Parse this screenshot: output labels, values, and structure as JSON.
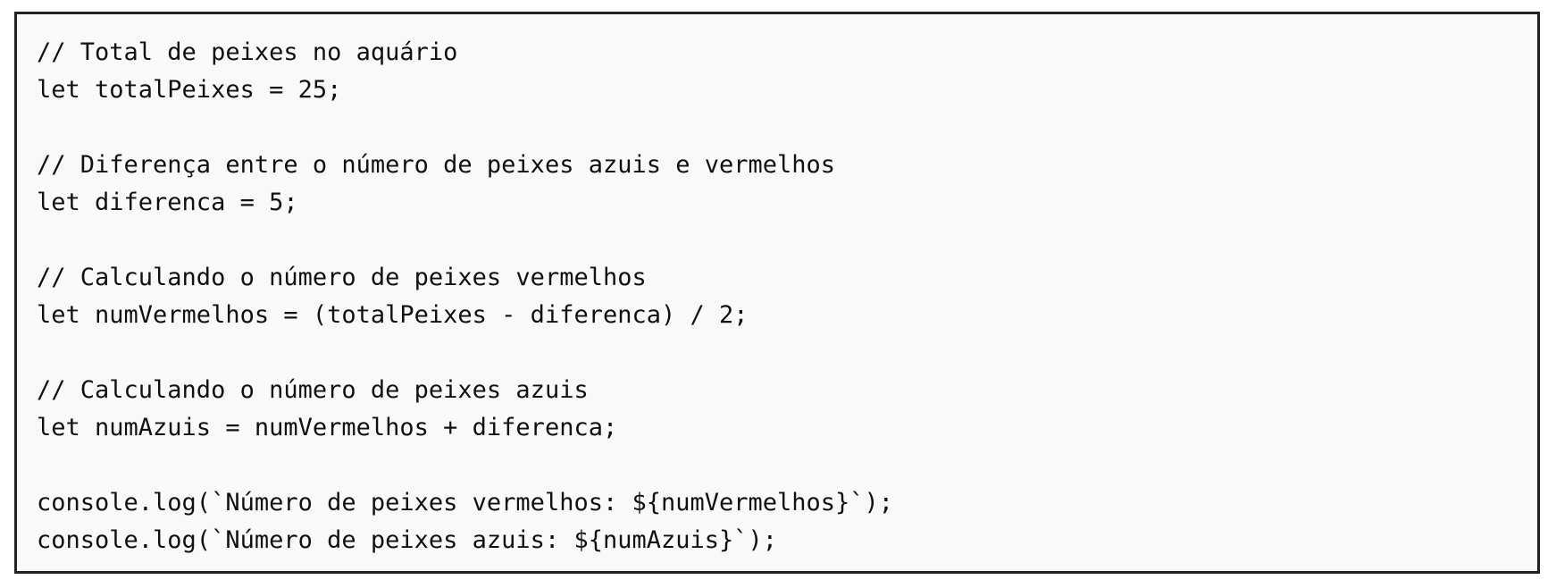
{
  "code_block": {
    "lines": [
      "// Total de peixes no aquário",
      "let totalPeixes = 25;",
      "",
      "// Diferença entre o número de peixes azuis e vermelhos",
      "let diferenca = 5;",
      "",
      "// Calculando o número de peixes vermelhos",
      "let numVermelhos = (totalPeixes - diferenca) / 2;",
      "",
      "// Calculando o número de peixes azuis",
      "let numAzuis = numVermelhos + diferenca;",
      "",
      "console.log(`Número de peixes vermelhos: ${numVermelhos}`);",
      "console.log(`Número de peixes azuis: ${numAzuis}`);"
    ]
  }
}
